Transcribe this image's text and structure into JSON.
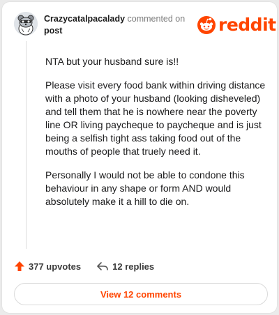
{
  "header": {
    "username": "Crazycatalpacalady",
    "action_text": "commented on",
    "target_text": "post"
  },
  "logo": {
    "word": "reddit",
    "icon": "reddit-snoo-icon",
    "color": "#ff4500"
  },
  "comment": {
    "paragraphs": [
      "NTA but your husband sure is!!",
      "Please visit every food bank within driving distance with a photo of your husband (looking disheveled) and tell them that he is nowhere near the poverty line OR living paycheque to paycheque and is just being a selfish tight ass taking food out of the mouths of people that truely need it.",
      "Personally I would not be able to condone this behaviour in any shape or form AND would absolutely make it a hill to die on."
    ]
  },
  "actions": {
    "upvotes": "377 upvotes",
    "upvote_icon": "upvote-arrow-icon",
    "replies": "12 replies",
    "reply_icon": "reply-arrow-icon"
  },
  "footer": {
    "view_comments_label": "View 12 comments"
  },
  "colors": {
    "accent": "#ff4500"
  }
}
